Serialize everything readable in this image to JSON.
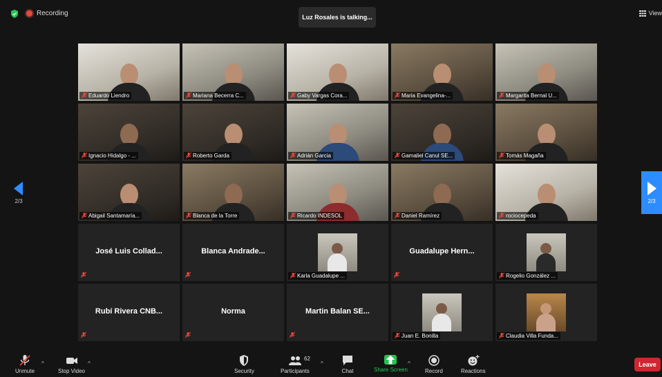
{
  "meeting": {
    "recording_label": "Recording",
    "talking_banner": "Luz Rosales is talking...",
    "view_label": "View",
    "page_indicator": "2/3"
  },
  "tiles": [
    {
      "name": "Eduardo Liendro",
      "type": "video"
    },
    {
      "name": "Mariana Becerra C...",
      "type": "video"
    },
    {
      "name": "Gaby Vargas Cora...",
      "type": "video"
    },
    {
      "name": "Maria Evangelina-...",
      "type": "video"
    },
    {
      "name": "Margarita Bernal U...",
      "type": "video"
    },
    {
      "name": "Ignacio Hidalgo - ...",
      "type": "video"
    },
    {
      "name": "Roberto Garda",
      "type": "video"
    },
    {
      "name": "Adrián Garcia",
      "type": "video"
    },
    {
      "name": "Gamaliel Canul SE...",
      "type": "video"
    },
    {
      "name": "Tomás Magaña",
      "type": "video"
    },
    {
      "name": "Abigail Santamaría...",
      "type": "video"
    },
    {
      "name": "Blanca de la Torre",
      "type": "video"
    },
    {
      "name": "Ricardo INDESOL",
      "type": "video"
    },
    {
      "name": "Daniel Ramírez",
      "type": "video"
    },
    {
      "name": "rociocepeda",
      "type": "video"
    },
    {
      "name": "José Luis Collad...",
      "type": "name"
    },
    {
      "name": "Blanca Andrade...",
      "type": "name"
    },
    {
      "name": "Karla Guadalupe ...",
      "type": "picture"
    },
    {
      "name": "Guadalupe Hern...",
      "type": "name"
    },
    {
      "name": "Rogelio González ...",
      "type": "picture"
    },
    {
      "name": "Rubí Rivera CNB...",
      "type": "name"
    },
    {
      "name": "Norma",
      "type": "name"
    },
    {
      "name": "Martin Balan SE...",
      "type": "name"
    },
    {
      "name": "Juan E. Bonilla",
      "type": "picture"
    },
    {
      "name": "Claudia Villa Funda...",
      "type": "picture"
    }
  ],
  "toolbar": {
    "unmute": "Unmute",
    "stop_video": "Stop Video",
    "security": "Security",
    "participants": "Participants",
    "participants_count": "62",
    "chat": "Chat",
    "share_screen": "Share Screen",
    "record": "Record",
    "reactions": "Reactions",
    "leave": "Leave"
  },
  "colors": {
    "background": "#141414",
    "accent_blue": "#2d8cff",
    "share_green": "#23c552",
    "leave_red": "#d0262f",
    "muted_red": "#e8483c"
  }
}
